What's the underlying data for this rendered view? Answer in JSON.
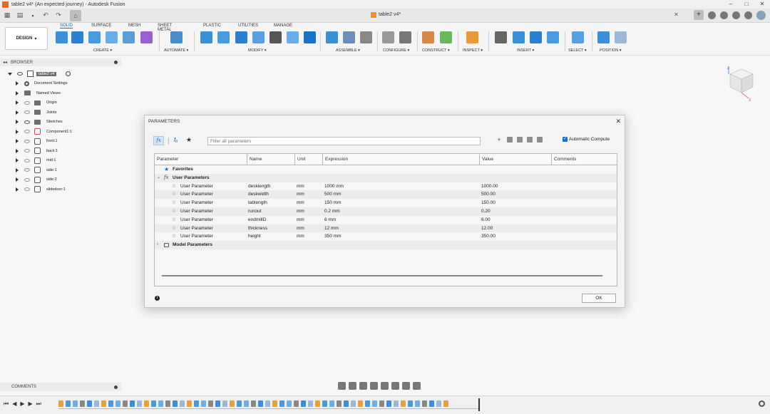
{
  "window": {
    "title": "table2 v4* (An expected journey) - Autodesk Fusion",
    "controls": [
      "–",
      "□",
      "✕"
    ]
  },
  "document_tab": {
    "label": "table2 v4*"
  },
  "ribbon": {
    "workspace": "DESIGN",
    "tabs": [
      "SOLID",
      "SURFACE",
      "MESH",
      "SHEET METAL",
      "PLASTIC",
      "UTILITIES",
      "MANAGE"
    ],
    "active_tab": "SOLID",
    "groups": [
      "CREATE",
      "AUTOMATE",
      "MODIFY",
      "ASSEMBLE",
      "CONFIGURE",
      "CONSTRUCT",
      "INSPECT",
      "INSERT",
      "SELECT",
      "POSITION"
    ],
    "colors": {
      "accent": "#0d6fc2",
      "brand": "#e86a1c"
    }
  },
  "browser": {
    "title": "BROWSER",
    "root": "table2 v4",
    "items": [
      {
        "label": "Document Settings",
        "kind": "settings"
      },
      {
        "label": "Named Views",
        "kind": "folder"
      },
      {
        "label": "Origin",
        "kind": "folder"
      },
      {
        "label": "Joints",
        "kind": "folder"
      },
      {
        "label": "Sketches",
        "kind": "folder"
      },
      {
        "label": "Component1:1",
        "kind": "component"
      },
      {
        "label": "front:1",
        "kind": "component"
      },
      {
        "label": "back:1",
        "kind": "component"
      },
      {
        "label": "mid:1",
        "kind": "component"
      },
      {
        "label": "side:1",
        "kind": "component"
      },
      {
        "label": "side:2",
        "kind": "component"
      },
      {
        "label": "slidedoor:1",
        "kind": "component"
      }
    ]
  },
  "dialog": {
    "title": "PARAMETERS",
    "filter_placeholder": "Filter all parameters",
    "auto_compute_label": "Automatic Compute",
    "auto_compute_checked": true,
    "columns": [
      "Parameter",
      "Name",
      "Unit",
      "Expression",
      "Value",
      "Comments"
    ],
    "favorites_label": "Favorites",
    "user_params_label": "User Parameters",
    "model_params_label": "Model Parameters",
    "rows": [
      {
        "parameter": "User Parameter",
        "name": "desklength",
        "unit": "mm",
        "expression": "1000 mm",
        "value": "1000.00",
        "comments": ""
      },
      {
        "parameter": "User Parameter",
        "name": "deskwidth",
        "unit": "mm",
        "expression": "500 mm",
        "value": "500.00",
        "comments": ""
      },
      {
        "parameter": "User Parameter",
        "name": "tablength",
        "unit": "mm",
        "expression": "150 mm",
        "value": "150.00",
        "comments": ""
      },
      {
        "parameter": "User Parameter",
        "name": "runout",
        "unit": "mm",
        "expression": "0.2 mm",
        "value": "0.20",
        "comments": ""
      },
      {
        "parameter": "User Parameter",
        "name": "endmillD",
        "unit": "mm",
        "expression": "6 mm",
        "value": "6.00",
        "comments": ""
      },
      {
        "parameter": "User Parameter",
        "name": "thickness",
        "unit": "mm",
        "expression": "12 mm",
        "value": "12.00",
        "comments": ""
      },
      {
        "parameter": "User Parameter",
        "name": "height",
        "unit": "mm",
        "expression": "350 mm",
        "value": "350.00",
        "comments": ""
      }
    ],
    "ok_label": "OK"
  },
  "comments": {
    "title": "COMMENTS"
  }
}
